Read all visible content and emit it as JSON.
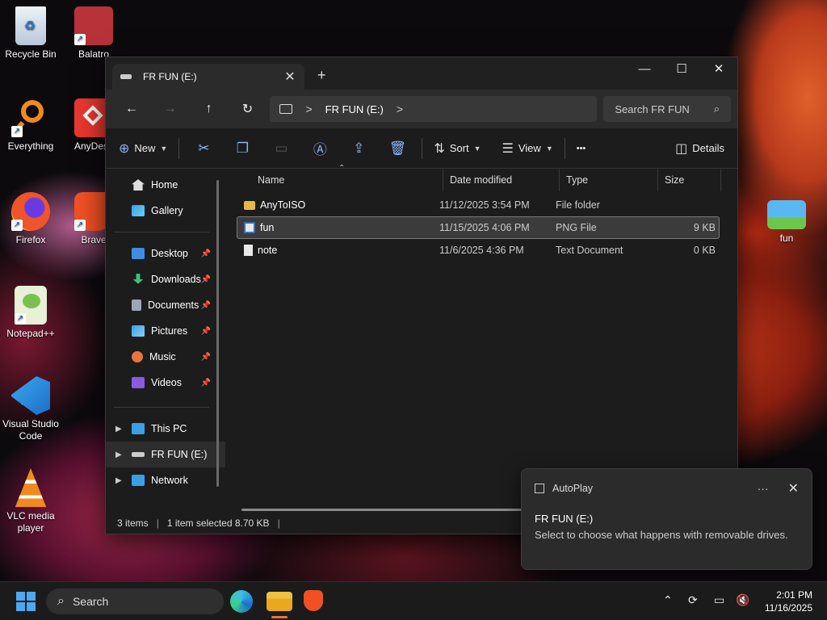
{
  "desktop": {
    "icons": [
      {
        "label": "Recycle Bin"
      },
      {
        "label": "Balatro"
      },
      {
        "label": "Everything"
      },
      {
        "label": "AnyDesk"
      },
      {
        "label": "Firefox"
      },
      {
        "label": "Brave"
      },
      {
        "label": "Notepad++"
      },
      {
        "label": "Visual Studio Code"
      },
      {
        "label": "VLC media player"
      },
      {
        "label": "fun"
      }
    ]
  },
  "window": {
    "tab_title": "FR FUN (E:)",
    "new_tab_symbol": "+",
    "controls": {
      "minimize": "—",
      "maximize": "☐",
      "close": "✕"
    },
    "nav": {
      "back": "←",
      "forward": "→",
      "up": "↑",
      "refresh": "↻"
    },
    "breadcrumb": {
      "separator": ">",
      "drive": "FR FUN (E:)",
      "trailing": ">"
    },
    "search_placeholder": "Search  FR FUN",
    "toolbar": {
      "new_label": "New",
      "sort_label": "Sort",
      "view_label": "View",
      "more_label": "•••",
      "details_label": "Details"
    },
    "sidebar": {
      "home": "Home",
      "gallery": "Gallery",
      "quick": [
        {
          "label": "Desktop",
          "color": "#3d8ee0"
        },
        {
          "label": "Downloads",
          "color": "#3cc07a"
        },
        {
          "label": "Documents",
          "color": "#9aa7b8"
        },
        {
          "label": "Pictures",
          "color": "#3aa0e6"
        },
        {
          "label": "Music",
          "color": "#e8743a"
        },
        {
          "label": "Videos",
          "color": "#8a5ae0"
        }
      ],
      "this_pc": "This PC",
      "drive": "FR FUN (E:)",
      "network": "Network"
    },
    "columns": {
      "name": "Name",
      "date": "Date modified",
      "type": "Type",
      "size": "Size"
    },
    "files": [
      {
        "name": "AnyToISO",
        "date": "11/12/2025 3:54 PM",
        "type": "File folder",
        "size": "",
        "icon": "folder-icon"
      },
      {
        "name": "fun",
        "date": "11/15/2025 4:06 PM",
        "type": "PNG File",
        "size": "9 KB",
        "icon": "png-file-icon"
      },
      {
        "name": "note",
        "date": "11/6/2025 4:36 PM",
        "type": "Text Document",
        "size": "0 KB",
        "icon": "text-file-icon"
      }
    ],
    "status": {
      "count": "3 items",
      "selection": "1 item selected  8.70 KB"
    }
  },
  "toast": {
    "app": "AutoPlay",
    "more": "···",
    "close": "✕",
    "title": "FR FUN (E:)",
    "message": "Select to choose what happens with removable drives."
  },
  "taskbar": {
    "search_label": "Search",
    "time": "2:01 PM",
    "date": "11/16/2025"
  },
  "colors": {
    "accent": "#4ca8f0",
    "window_bg": "#1c1c1c"
  }
}
